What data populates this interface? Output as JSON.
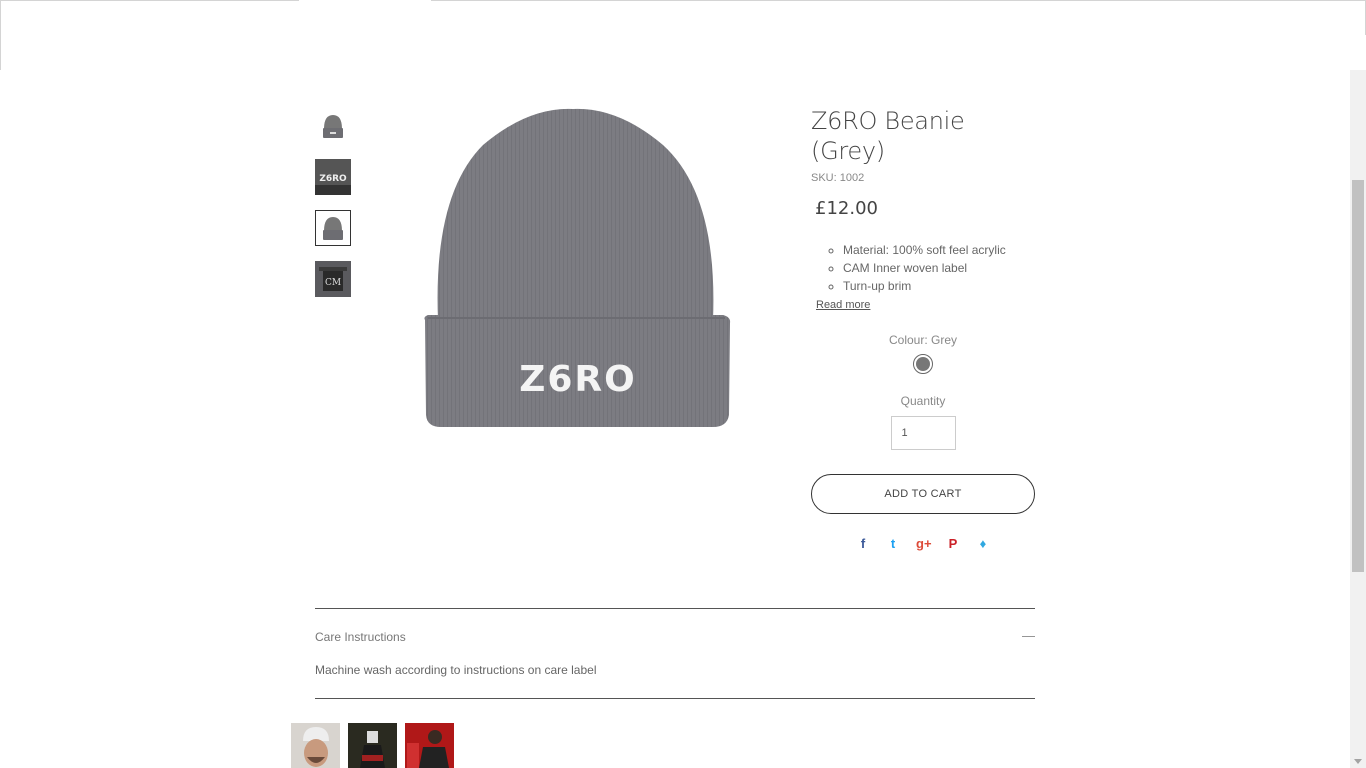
{
  "product": {
    "title_line1": "Z6RO Beanie",
    "title_line2": "(Grey)",
    "sku": "SKU: 1002",
    "price": "£12.00",
    "features": [
      "Material: 100% soft feel acrylic",
      "CAM Inner woven label",
      "Turn-up brim"
    ],
    "read_more": "Read more",
    "colour_label": "Colour: Grey",
    "quantity_label": "Quantity",
    "quantity_value": "1",
    "add_to_cart": "ADD TO CART",
    "beanie_logo_text": "Z6RO",
    "beanie_color": "#7a7a80"
  },
  "share": [
    {
      "icon": "facebook-icon",
      "glyph": "f",
      "color": "#3b5998"
    },
    {
      "icon": "twitter-icon",
      "glyph": "t",
      "color": "#1da1f2"
    },
    {
      "icon": "google-plus-icon",
      "glyph": "g+",
      "color": "#dd4b39"
    },
    {
      "icon": "pinterest-icon",
      "glyph": "P",
      "color": "#cb2027"
    },
    {
      "icon": "fancy-icon",
      "glyph": "♦",
      "color": "#30a8e0"
    }
  ],
  "care": {
    "heading": "Care Instructions",
    "toggle": "—",
    "text": "Machine wash according to instructions on care label"
  },
  "thumbnails": [
    {
      "icon": "beanie-thumbnail"
    },
    {
      "icon": "logo-closeup-thumbnail",
      "text": "Z6RO"
    },
    {
      "icon": "beanie-thumbnail"
    },
    {
      "icon": "label-thumbnail",
      "text": "CM"
    }
  ]
}
